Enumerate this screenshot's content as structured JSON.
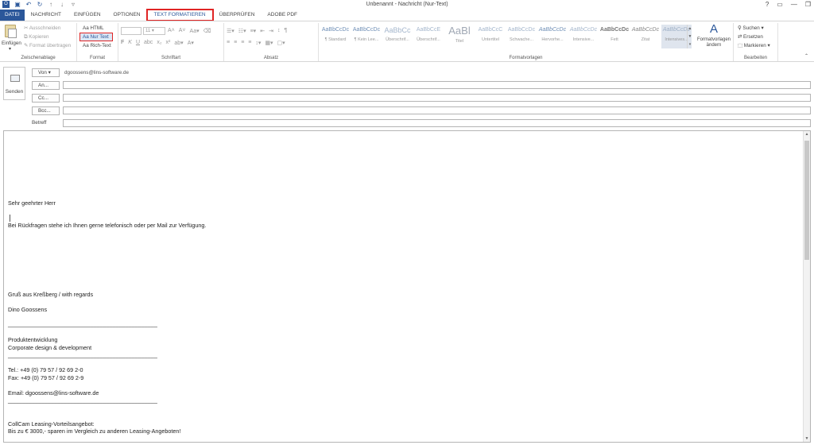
{
  "window": {
    "title": "Unbenannt - Nachricht (Nur-Text)",
    "controls": [
      "?",
      "▭",
      "—",
      "❐"
    ],
    "qat_icons": [
      "outlook-icon",
      "save-icon",
      "undo-icon",
      "redo-icon",
      "up-arrow-icon",
      "down-arrow-icon",
      "customize-icon"
    ]
  },
  "tabs": [
    {
      "label": "DATEI"
    },
    {
      "label": "NACHRICHT"
    },
    {
      "label": "EINFÜGEN"
    },
    {
      "label": "OPTIONEN"
    },
    {
      "label": "TEXT FORMATIEREN"
    },
    {
      "label": "ÜBERPRÜFEN"
    },
    {
      "label": "ADOBE PDF"
    }
  ],
  "ribbon": {
    "clipboard": {
      "group_label": "Zwischenablage",
      "paste": "Einfügen",
      "cut": "Ausschneiden",
      "copy": "Kopieren",
      "format_painter": "Format übertragen"
    },
    "format": {
      "group_label": "Format",
      "html": "Aa HTML",
      "plain": "Aa Nur Text",
      "rich": "Aa Rich-Text"
    },
    "font": {
      "group_label": "Schriftart",
      "size": "11",
      "bold": "F",
      "italic": "K",
      "underline": "U"
    },
    "paragraph": {
      "group_label": "Absatz"
    },
    "styles": {
      "group_label": "Formatvorlagen",
      "items": [
        {
          "sample": "AaBbCcDc",
          "name": "¶ Standard"
        },
        {
          "sample": "AaBbCcDc",
          "name": "¶ Kein Lee..."
        },
        {
          "sample": "AaBbCc",
          "name": "Überschrif..."
        },
        {
          "sample": "AaBbCcE",
          "name": "Überschrif..."
        },
        {
          "sample": "AaBl",
          "name": "Titel"
        },
        {
          "sample": "AaBbCcC",
          "name": "Untertitel"
        },
        {
          "sample": "AaBbCcDc",
          "name": "Schwache..."
        },
        {
          "sample": "AaBbCcDc",
          "name": "Hervorhe..."
        },
        {
          "sample": "AaBbCcDc",
          "name": "Intensive..."
        },
        {
          "sample": "AaBbCcDc",
          "name": "Fett"
        },
        {
          "sample": "AaBbCcDc",
          "name": "Zitat"
        },
        {
          "sample": "AaBbCcDc",
          "name": "Intensives..."
        }
      ],
      "change_styles": "Formatvorlagen ändern"
    },
    "editing": {
      "group_label": "Bearbeiten",
      "find": "Suchen",
      "replace": "Ersetzen",
      "select": "Markieren"
    }
  },
  "header": {
    "send": "Senden",
    "from_button": "Von",
    "from_value": "dgoossens@lins-software.de",
    "to_button": "An...",
    "cc_button": "Cc...",
    "bcc_button": "Bcc...",
    "subject_label": "Betreff"
  },
  "body": {
    "lines": [
      "Sehr geehrter Herr",
      "Bei Rückfragen stehe ich Ihnen gerne telefonisch oder per Mail zur Verfügung.",
      "Gruß aus Kreßberg / with regards",
      "Dino Goossens",
      "_______________________________________________",
      "Produktentwicklung",
      "Corporate design & development",
      "_______________________________________________",
      "Tel.: +49 (0) 79 57 / 92 69 2-0",
      "Fax: +49 (0) 79 57 / 92 69 2-9",
      "Email: dgoossens@lins-software.de",
      "_______________________________________________",
      "CollCam Leasing-Vorteilsangebot:",
      "Bis zu € 3000,- sparen im Vergleich zu anderen Leasing-Angeboten!"
    ]
  }
}
